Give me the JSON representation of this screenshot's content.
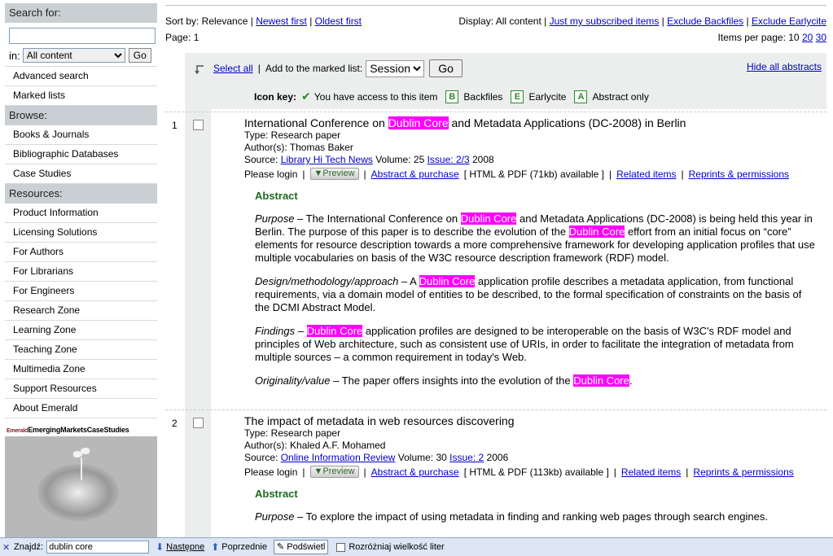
{
  "sidebar": {
    "search_header": "Search for:",
    "search_value": "",
    "in_label": "in:",
    "in_selected": "All content",
    "go_label": "Go",
    "links_top": [
      "Advanced search",
      "Marked lists"
    ],
    "browse_header": "Browse:",
    "browse_items": [
      "Books & Journals",
      "Bibliographic Databases",
      "Case Studies"
    ],
    "resources_header": "Resources:",
    "resources_items": [
      "Product Information",
      "Licensing Solutions",
      "For Authors",
      "For Librarians",
      "For Engineers",
      "Research Zone",
      "Learning Zone",
      "Teaching Zone",
      "Multimedia Zone",
      "Support Resources",
      "About Emerald"
    ],
    "promo_brand": "Emerald",
    "promo_title": "EmergingMarketsCaseStudies"
  },
  "topbar": {
    "sort_label": "Sort by: Relevance |",
    "sort_newest": "Newest first",
    "sort_oldest": "Oldest first",
    "display_label": "Display: All content |",
    "display_subscribed": "Just my subscribed items",
    "display_excl_backfiles": "Exclude Backfiles",
    "display_excl_earlycite": "Exclude Earlycite",
    "page_label": "Page: 1",
    "per_page_label": "Items per page: 10",
    "per_page_20": "20",
    "per_page_30": "30"
  },
  "toolbar": {
    "select_all": "Select all",
    "add_label": "Add to the marked list:",
    "list_selected": "Session",
    "go_label": "Go",
    "hide_abstracts": "Hide all abstracts",
    "icon_key_label": "Icon key:",
    "key_access": "You have access to this item",
    "key_backfiles_letter": "B",
    "key_backfiles": "Backfiles",
    "key_earlycite_letter": "E",
    "key_earlycite": "Earlycite",
    "key_abstract_letter": "A",
    "key_abstract": "Abstract only"
  },
  "common": {
    "please_login": "Please login",
    "preview": "Preview",
    "abstract_purchase": "Abstract & purchase",
    "related": "Related items",
    "reprints": "Reprints & permissions",
    "abstract_heading": "Abstract",
    "highlight_term": "Dublin Core"
  },
  "results": [
    {
      "num": "1",
      "title_pre": "International Conference on ",
      "title_post": " and Metadata Applications (DC-2008) in Berlin",
      "type": "Type: Research paper",
      "authors": "Author(s): Thomas Baker",
      "source_label": "Source:",
      "journal": "Library Hi Tech News",
      "volume": "Volume: 25",
      "issue": "Issue: 2/3",
      "year": "2008",
      "format": "[ HTML & PDF (71kb) available ]",
      "abs_purpose_label": "Purpose",
      "abs_purpose_1": " – The International Conference on ",
      "abs_purpose_2": " and Metadata Applications (DC-2008) is being held this year in Berlin. The purpose of this paper is to describe the evolution of the ",
      "abs_purpose_3": " effort from an initial focus on “core” elements for resource description towards a more comprehensive framework for developing application profiles that use multiple vocabularies on basis of the W3C resource description framework (RDF) model.",
      "abs_design_label": "Design/methodology/approach",
      "abs_design_1": " – A ",
      "abs_design_2": " application profile describes a metadata application, from functional requirements, via a domain model of entities to be described, to the formal specification of constraints on the basis of the DCMI Abstract Model.",
      "abs_findings_label": "Findings",
      "abs_findings_1": " – ",
      "abs_findings_2": " application profiles are designed to be interoperable on the basis of W3C's RDF model and principles of Web architecture, such as consistent use of URIs, in order to facilitate the integration of metadata from multiple sources – a common requirement in today's Web.",
      "abs_orig_label": "Originality/value",
      "abs_orig_1": " – The paper offers insights into the evolution of the ",
      "abs_orig_2": "."
    },
    {
      "num": "2",
      "title": "The impact of metadata in web resources discovering",
      "type": "Type: Research paper",
      "authors": "Author(s): Khaled A.F. Mohamed",
      "source_label": "Source:",
      "journal": "Online Information Review",
      "volume": "Volume: 30",
      "issue": "Issue: 2",
      "year": "2006",
      "format": "[ HTML & PDF (113kb) available ]",
      "abs_purpose_label": "Purpose",
      "abs_purpose_1": " – To explore the impact of using metadata in finding and ranking web pages through search engines."
    }
  ],
  "findbar": {
    "label": "Znajdź:",
    "value": "dublin core",
    "next": "Następne",
    "prev": "Poprzednie",
    "highlight": "Podświetl",
    "match_case": "Rozróżniaj wielkość liter"
  }
}
